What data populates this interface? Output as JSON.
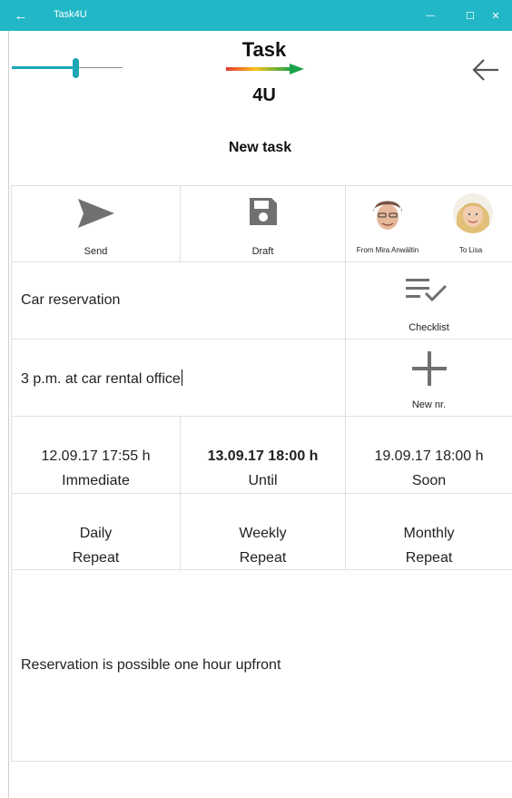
{
  "window": {
    "title": "Task4U",
    "back_glyph": "←",
    "minimize_glyph": "—",
    "maximize_glyph": "☐",
    "close_glyph": "✕"
  },
  "logo": {
    "line1": "Task",
    "line2": "4U"
  },
  "page": {
    "title": "New task"
  },
  "slider": {
    "value_fraction": 0.58
  },
  "actions": {
    "send_label": "Send",
    "draft_label": "Draft",
    "from_label": "From Mira Anwältin",
    "to_label": "To Lisa"
  },
  "task": {
    "title_value": "Car reservation",
    "location_value": "3 p.m. at car rental office",
    "checklist_label": "Checklist",
    "new_nr_label": "New nr.",
    "note_value": "Reservation is possible one hour upfront"
  },
  "deadlines": [
    {
      "datetime": "12.09.17 17:55 h",
      "label": "Immediate"
    },
    {
      "datetime": "13.09.17 18:00 h",
      "label": "Until"
    },
    {
      "datetime": "19.09.17 18:00 h",
      "label": "Soon"
    }
  ],
  "repeat": [
    {
      "period": "Daily",
      "label": "Repeat"
    },
    {
      "period": "Weekly",
      "label": "Repeat"
    },
    {
      "period": "Monthly",
      "label": "Repeat"
    }
  ],
  "colors": {
    "accent": "#22b7c6",
    "icon_gray": "#707070"
  }
}
